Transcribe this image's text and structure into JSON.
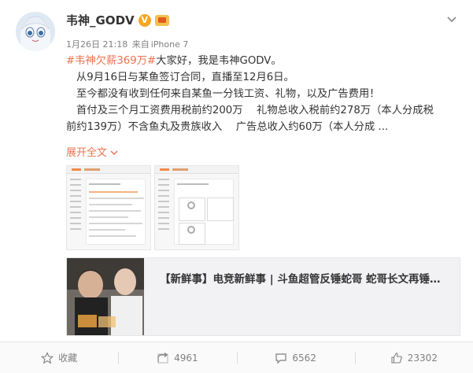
{
  "post": {
    "author": "韦神_GODV",
    "verified_badge": "V",
    "timestamp": "1月26日 21:18",
    "source_prefix": "来自",
    "source": "iPhone 7",
    "hashtag": "#韦神欠薪369万#",
    "line1_rest": "大家好，我是韦神GODV。",
    "line2": "从9月16日与某鱼签订合同，直播至12月6日。",
    "line3": "至今都没有收到任何来自某鱼一分钱工资、礼物，以及广告费用！",
    "line4": "首付及三个月工资费用税前约200万　 礼物总收入税前约278万（本人分成税",
    "line5": "前约139万）不含鱼丸及贵族收入　 广告总收入约60万（本人分成 ...",
    "expand_label": "展开全文",
    "expand_icon": "chevron-down-icon"
  },
  "link_card": {
    "title": "【新鲜事】电竞新鲜事 | 斗鱼超管反锤蛇哥 蛇哥长文再锤…"
  },
  "actions": {
    "favorite_label": "收藏",
    "repost_count": "4961",
    "comment_count": "6562",
    "like_count": "23302"
  },
  "colors": {
    "accent": "#eb7350",
    "badge_gold": "#f5a623",
    "text": "#333333",
    "muted": "#808080"
  }
}
